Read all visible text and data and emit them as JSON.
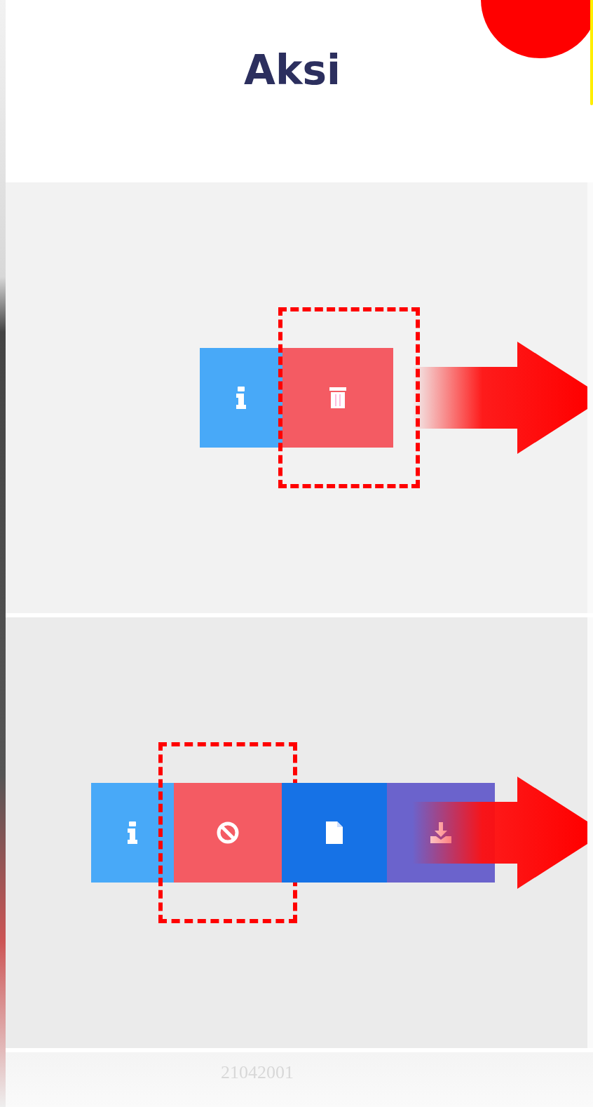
{
  "table": {
    "columns": [
      {
        "label": "Aksi"
      }
    ],
    "rows": [
      {
        "actions": [
          {
            "kind": "info",
            "highlighted": false
          },
          {
            "kind": "delete",
            "highlighted": true
          }
        ],
        "arrow": true
      },
      {
        "actions": [
          {
            "kind": "info",
            "highlighted": false
          },
          {
            "kind": "cancel",
            "highlighted": true
          },
          {
            "kind": "document",
            "highlighted": false
          },
          {
            "kind": "download",
            "highlighted": false
          }
        ],
        "arrow": true
      },
      {
        "cell": "21042001"
      }
    ]
  }
}
